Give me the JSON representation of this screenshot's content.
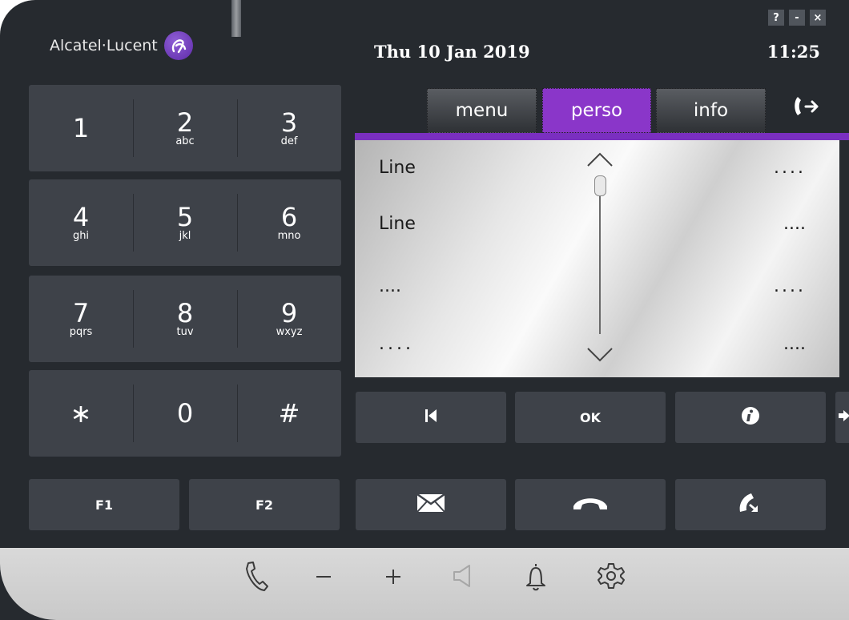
{
  "brand": {
    "name": "Alcatel·Lucent"
  },
  "header": {
    "date": "Thu 10 Jan 2019",
    "time": "11:25"
  },
  "window_controls": {
    "help": "?",
    "minimize": "-",
    "close": "×"
  },
  "keypad": {
    "rows": [
      [
        {
          "num": "1",
          "letters": ""
        },
        {
          "num": "2",
          "letters": "abc"
        },
        {
          "num": "3",
          "letters": "def"
        }
      ],
      [
        {
          "num": "4",
          "letters": "ghi"
        },
        {
          "num": "5",
          "letters": "jkl"
        },
        {
          "num": "6",
          "letters": "mno"
        }
      ],
      [
        {
          "num": "7",
          "letters": "pqrs"
        },
        {
          "num": "8",
          "letters": "tuv"
        },
        {
          "num": "9",
          "letters": "wxyz"
        }
      ],
      [
        {
          "num": "∗",
          "letters": ""
        },
        {
          "num": "0",
          "letters": ""
        },
        {
          "num": "#",
          "letters": ""
        }
      ]
    ],
    "f1": "F1",
    "f2": "F2"
  },
  "tabs": [
    {
      "label": "menu",
      "active": false
    },
    {
      "label": "perso",
      "active": true
    },
    {
      "label": "info",
      "active": false
    }
  ],
  "list": {
    "rows": [
      {
        "left": "Line",
        "right": "....",
        "right_spaced": true
      },
      {
        "left": "Line",
        "right": "....",
        "right_spaced": false
      },
      {
        "left": "....",
        "right": "....",
        "right_spaced": true
      },
      {
        "left": "....",
        "left_spaced": true,
        "right": "....",
        "right_spaced": false
      }
    ]
  },
  "actions": {
    "ok": "OK"
  },
  "icons": {
    "transfer": "call-transfer-icon",
    "first": "skip-back-icon",
    "info": "info-icon",
    "next": "arrow-right-icon",
    "mail": "mail-icon",
    "hangup": "hangup-icon",
    "redial": "redial-icon",
    "handset": "handset-icon",
    "volume_down": "minus-icon",
    "volume_up": "plus-icon",
    "speaker": "speaker-icon",
    "ringer": "bell-icon",
    "settings": "gear-icon"
  },
  "colors": {
    "accent": "#8a36c9",
    "body": "#262a2f",
    "key": "#3e4249"
  }
}
